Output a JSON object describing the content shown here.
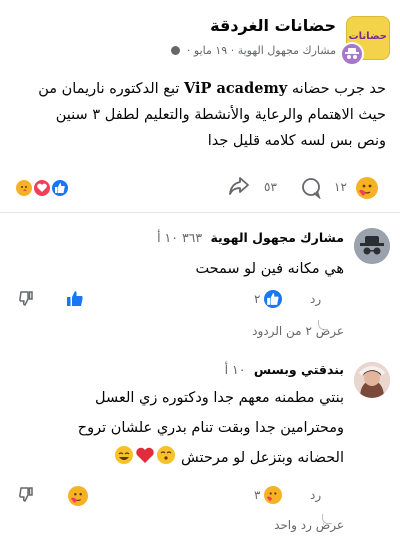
{
  "post": {
    "group_name": "حضانات الغردقة",
    "group_avatar_text": "حضانات",
    "author": "مشارك مجهول الهوية",
    "date": "١٩ مايو",
    "text_line1_pre": "حد جرب حضانه ",
    "brand": "ViP academy",
    "text_line1_post": " تبع الدكتوره ناريمان من",
    "text_line2": "حيث الاهتمام والرعاية والأنشطة والتعليم لطفل ٣ سنين",
    "text_line3": "ونص بس لسه كلامه قليل جدا",
    "reaction_count": "١٢",
    "comment_count": "٥٣"
  },
  "comments": [
    {
      "author": "مشارك مجهول الهوية",
      "time": "٣٦٣ ١٠ أ",
      "text": "هي مكانه فين لو سمحت",
      "reply_label": "رد",
      "reaction_count": "٢",
      "view_replies": "عرض ٢ من الردود"
    },
    {
      "author": "بندقتي وبسس",
      "time": "١٠ أ",
      "text_line1": "بنتي مطمنه معهم جدا ودكتوره زي العسل",
      "text_line2": "ومحترامين جدا وبقت تنام بدري علشان تروح",
      "text_line3": "الحضانه وبتزعل لو مرحتش",
      "reply_label": "رد",
      "reaction_count": "٣",
      "view_replies": "عرض رد واحد"
    }
  ],
  "colors": {
    "like": "#1877f2",
    "love": "#f33e58",
    "care": "#f7b125",
    "meta": "#65676b"
  }
}
